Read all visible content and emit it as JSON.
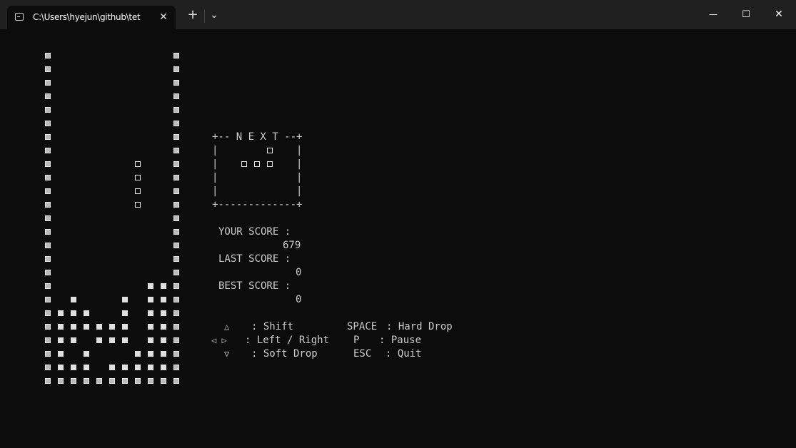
{
  "window": {
    "tab_title": "C:\\Users\\hyejun\\github\\tet",
    "tab_close": "✕",
    "new_tab": "+",
    "dropdown": "⌄",
    "minimize": "—",
    "maximize": "☐",
    "close": "✕"
  },
  "next_panel": {
    "top": "+-- N E X T --+",
    "side": "|             |",
    "bottom": "+-------------+",
    "piece_cells": [
      [
        4,
        1
      ],
      [
        2,
        2
      ],
      [
        3,
        2
      ],
      [
        4,
        2
      ]
    ]
  },
  "scores": {
    "your_label": "YOUR SCORE :",
    "your_value": "679",
    "last_label": "LAST SCORE :",
    "last_value": "0",
    "best_label": "BEST SCORE :",
    "best_value": "0"
  },
  "controls": {
    "shift_key": "△",
    "shift_label": ": Shift",
    "move_keys": "◁ ▷",
    "move_label": ": Left / Right",
    "drop_key": "▽",
    "drop_label": ": Soft Drop",
    "hard_key": "SPACE",
    "hard_label": ": Hard Drop",
    "pause_key": "P",
    "pause_label": ": Pause",
    "quit_key": "ESC",
    "quit_label": ": Quit"
  },
  "board": {
    "cols": 10,
    "rows": 25,
    "live_piece": [
      [
        7,
        8
      ],
      [
        7,
        9
      ],
      [
        7,
        10
      ],
      [
        7,
        11
      ]
    ],
    "locked_rows": [
      {
        "row": 17,
        "cols": [
          8,
          9
        ]
      },
      {
        "row": 18,
        "cols": [
          2,
          6,
          8,
          9
        ]
      },
      {
        "row": 19,
        "cols": [
          1,
          2,
          3,
          6,
          8,
          9
        ]
      },
      {
        "row": 20,
        "cols": [
          1,
          2,
          3,
          4,
          5,
          6,
          8,
          9
        ]
      },
      {
        "row": 21,
        "cols": [
          1,
          2,
          4,
          5,
          6,
          8,
          9
        ]
      },
      {
        "row": 22,
        "cols": [
          1,
          3,
          7,
          8,
          9
        ]
      },
      {
        "row": 23,
        "cols": [
          1,
          2,
          3,
          5,
          6,
          7,
          8,
          9
        ]
      }
    ]
  }
}
